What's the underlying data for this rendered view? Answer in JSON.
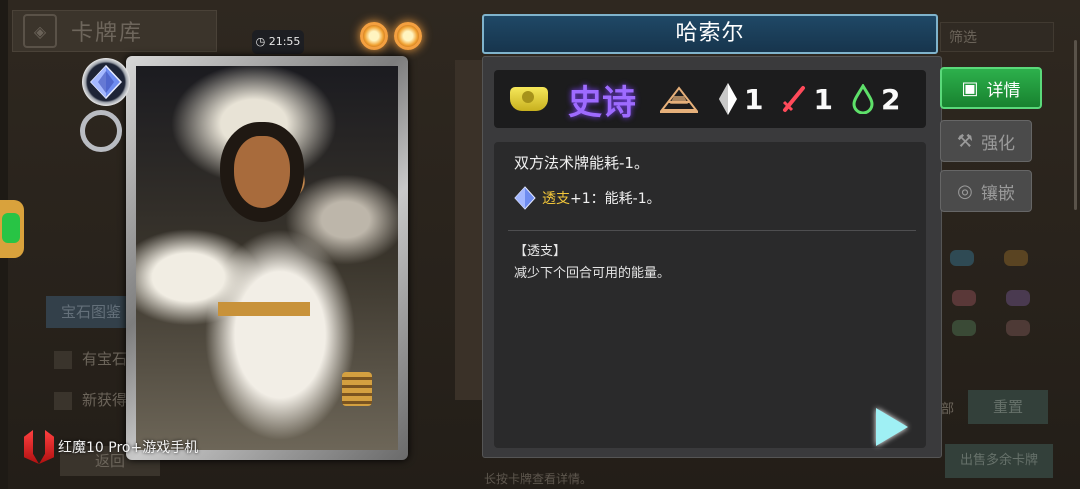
{
  "background": {
    "library_title": "卡牌库",
    "filter_label": "筛选",
    "gem_catalog_tab": "宝石图鉴",
    "checkbox_has_gem": "有宝石",
    "checkbox_new": "新获得",
    "back_button": "返回",
    "reset_button": "重置",
    "tab_all": "全部",
    "sell_extra_button": "出售多余卡牌",
    "hint_text": "长按卡牌查看详情。"
  },
  "status": {
    "time": "21:55"
  },
  "device_watermark": "红魔10 Pro+游戏手机",
  "card": {
    "name": "哈索尔",
    "rarity_label": "史诗",
    "stats": {
      "cost_crystal": "1",
      "attack_dagger": "1",
      "drop_green": "2"
    },
    "description": "双方法术牌能耗-1。",
    "gem_keyword": "透支",
    "gem_effect": "+1：能耗-1。",
    "glossary_title": "【透支】",
    "glossary_body": "减少下个回合可用的能量。"
  },
  "buttons": {
    "detail": "详情",
    "enhance": "强化",
    "inlay": "镶嵌"
  },
  "colors": {
    "rarity_epic": "#9e6bff",
    "keyword": "#f2c63a",
    "detail_button": "#2db04c",
    "name_bar": "#1f4866"
  },
  "icons": [
    "rarity-gem-icon",
    "pyramid-icon",
    "crystal-icon",
    "dagger-icon",
    "drop-icon",
    "gem-icon",
    "play-icon",
    "detail-icon",
    "enhance-icon",
    "inlay-icon"
  ]
}
